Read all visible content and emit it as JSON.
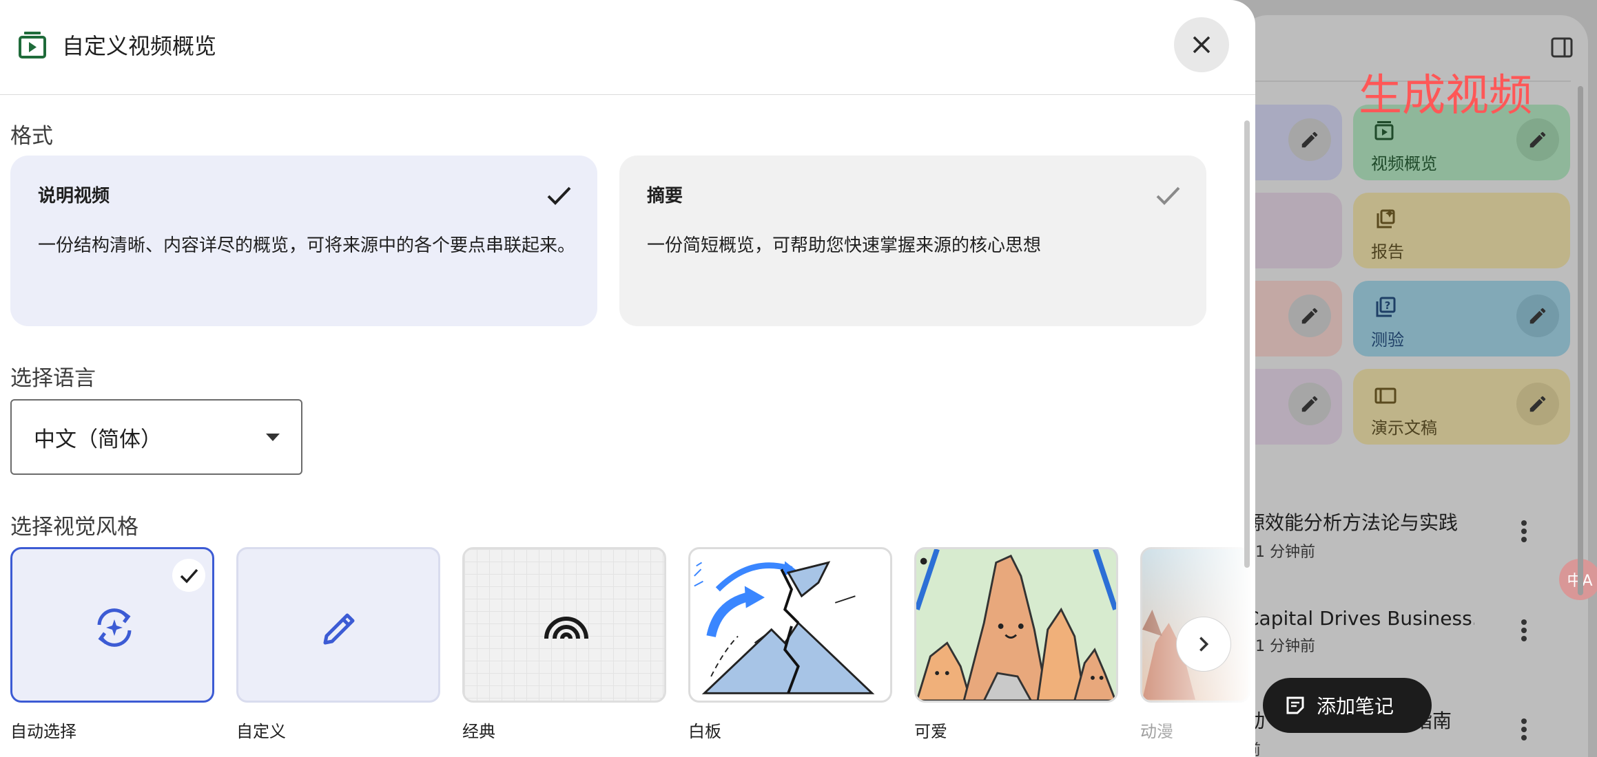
{
  "dialog": {
    "title": "自定义视频概览",
    "format_label": "格式",
    "formats": [
      {
        "title": "说明视频",
        "desc": "一份结构清晰、内容详尽的概览，可将来源中的各个要点串联起来。",
        "selected": true
      },
      {
        "title": "摘要",
        "desc": "一份简短概览，可帮助您快速掌握来源的核心思想",
        "selected": false
      }
    ],
    "language_label": "选择语言",
    "language_value": "中文（简体）",
    "style_label": "选择视觉风格",
    "styles": [
      {
        "label": "自动选择",
        "icon": "auto-awesome-icon",
        "selected": true
      },
      {
        "label": "自定义",
        "icon": "pencil-icon",
        "selected": false
      },
      {
        "label": "经典",
        "icon": "rainbow-icon",
        "selected": false
      },
      {
        "label": "白板",
        "icon": "volcano-sketch-thumbnail",
        "selected": false
      },
      {
        "label": "可爱",
        "icon": "cute-mountains-thumbnail",
        "selected": false
      },
      {
        "label": "动漫",
        "icon": "anime-thumbnail",
        "selected": false
      }
    ]
  },
  "studio": {
    "annotation": "生成视频",
    "tiles": [
      {
        "label": "视频概览",
        "icon": "video-overview-icon",
        "color": "#8fb79a"
      },
      {
        "label": "报告",
        "icon": "report-icon",
        "color": "#bfb489"
      },
      {
        "label": "测验",
        "icon": "quiz-icon",
        "color": "#82a9b7"
      },
      {
        "label": "演示文稿",
        "icon": "slides-icon",
        "color": "#bfb489"
      }
    ],
    "notes": [
      {
        "title": "源效能分析方法论与实践",
        "meta": "· 1 分钟前"
      },
      {
        "title": "Capital Drives Business...",
        "meta": "· 1 分钟前"
      },
      {
        "title": "动",
        "title_end": "指南",
        "meta": "前"
      }
    ],
    "add_note_label": "添加笔记",
    "translate_badge": "中A"
  },
  "colors": {
    "accent": "#3c5bd4",
    "selected_card": "#eceef9",
    "card_bg": "#f1f1f1",
    "dialog_icon": "#1f6b3a"
  }
}
